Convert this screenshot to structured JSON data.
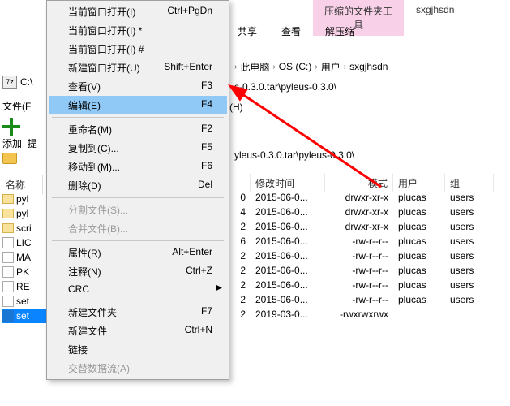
{
  "ribbon": {
    "pink_tab": "压缩的文件夹工具",
    "user": "sxgjhsdn",
    "btn_share": "共享",
    "btn_view": "查看",
    "btn_extract": "解压缩"
  },
  "breadcrumb": {
    "thispc": "此电脑",
    "drive": "OS (C:)",
    "users": "用户",
    "user": "sxgjhsdn"
  },
  "pathbar": {
    "path": "s-0.3.0.tar\\pyleus-0.3.0\\"
  },
  "pathlabel": {
    "label": "(H)"
  },
  "pathbar2": {
    "path": "yleus-0.3.0.tar\\pyleus-0.3.0\\"
  },
  "sevenz": {
    "title": "C:\\",
    "menu_file": "文件(F",
    "toolbar_add": "添加",
    "toolbar_extract": "提",
    "addr_blank": ""
  },
  "left_header": {
    "name": "名称"
  },
  "left_list": [
    {
      "icon": "folder",
      "name": "pyl"
    },
    {
      "icon": "folder",
      "name": "pyl"
    },
    {
      "icon": "folder",
      "name": "scri"
    },
    {
      "icon": "blank",
      "name": "LIC"
    },
    {
      "icon": "blank",
      "name": "MA"
    },
    {
      "icon": "blank",
      "name": "PK"
    },
    {
      "icon": "blank",
      "name": "RE"
    },
    {
      "icon": "blank",
      "name": "set"
    },
    {
      "icon": "py",
      "name": "set",
      "selected": true
    }
  ],
  "right_header": {
    "date": "修改时间",
    "mode": "模式",
    "user": "用户",
    "group": "组"
  },
  "right_rows": [
    {
      "size": "0",
      "date": "2015-06-0...",
      "mode": "drwxr-xr-x",
      "user": "plucas",
      "group": "users"
    },
    {
      "size": "4",
      "date": "2015-06-0...",
      "mode": "drwxr-xr-x",
      "user": "plucas",
      "group": "users"
    },
    {
      "size": "2",
      "date": "2015-06-0...",
      "mode": "drwxr-xr-x",
      "user": "plucas",
      "group": "users"
    },
    {
      "size": "6",
      "date": "2015-06-0...",
      "mode": "-rw-r--r--",
      "user": "plucas",
      "group": "users"
    },
    {
      "size": "2",
      "date": "2015-06-0...",
      "mode": "-rw-r--r--",
      "user": "plucas",
      "group": "users"
    },
    {
      "size": "2",
      "date": "2015-06-0...",
      "mode": "-rw-r--r--",
      "user": "plucas",
      "group": "users"
    },
    {
      "size": "2",
      "date": "2015-06-0...",
      "mode": "-rw-r--r--",
      "user": "plucas",
      "group": "users"
    },
    {
      "size": "2",
      "date": "2015-06-0...",
      "mode": "-rw-r--r--",
      "user": "plucas",
      "group": "users"
    },
    {
      "size": "2",
      "date": "2019-03-0...",
      "mode": "-rwxrwxrwx",
      "user": "",
      "group": ""
    }
  ],
  "ctxmenu": [
    {
      "type": "item",
      "label": "当前窗口打开(I)",
      "shortcut": "Ctrl+PgDn"
    },
    {
      "type": "item",
      "label": "当前窗口打开(I) *",
      "shortcut": ""
    },
    {
      "type": "item",
      "label": "当前窗口打开(I) #",
      "shortcut": ""
    },
    {
      "type": "item",
      "label": "新建窗口打开(U)",
      "shortcut": "Shift+Enter"
    },
    {
      "type": "item",
      "label": "查看(V)",
      "shortcut": "F3"
    },
    {
      "type": "item",
      "label": "编辑(E)",
      "shortcut": "F4",
      "highlighted": true
    },
    {
      "type": "sep"
    },
    {
      "type": "item",
      "label": "重命名(M)",
      "shortcut": "F2"
    },
    {
      "type": "item",
      "label": "复制到(C)...",
      "shortcut": "F5"
    },
    {
      "type": "item",
      "label": "移动到(M)...",
      "shortcut": "F6"
    },
    {
      "type": "item",
      "label": "删除(D)",
      "shortcut": "Del"
    },
    {
      "type": "sep"
    },
    {
      "type": "item",
      "label": "分割文件(S)...",
      "shortcut": "",
      "disabled": true
    },
    {
      "type": "item",
      "label": "合并文件(B)...",
      "shortcut": "",
      "disabled": true
    },
    {
      "type": "sep"
    },
    {
      "type": "item",
      "label": "属性(R)",
      "shortcut": "Alt+Enter"
    },
    {
      "type": "item",
      "label": "注释(N)",
      "shortcut": "Ctrl+Z"
    },
    {
      "type": "item",
      "label": "CRC",
      "shortcut": "",
      "submenu": true
    },
    {
      "type": "sep"
    },
    {
      "type": "item",
      "label": "新建文件夹",
      "shortcut": "F7"
    },
    {
      "type": "item",
      "label": "新建文件",
      "shortcut": "Ctrl+N"
    },
    {
      "type": "item",
      "label": "链接",
      "shortcut": ""
    },
    {
      "type": "item",
      "label": "交替数据流(A)",
      "shortcut": "",
      "disabled": true
    }
  ]
}
